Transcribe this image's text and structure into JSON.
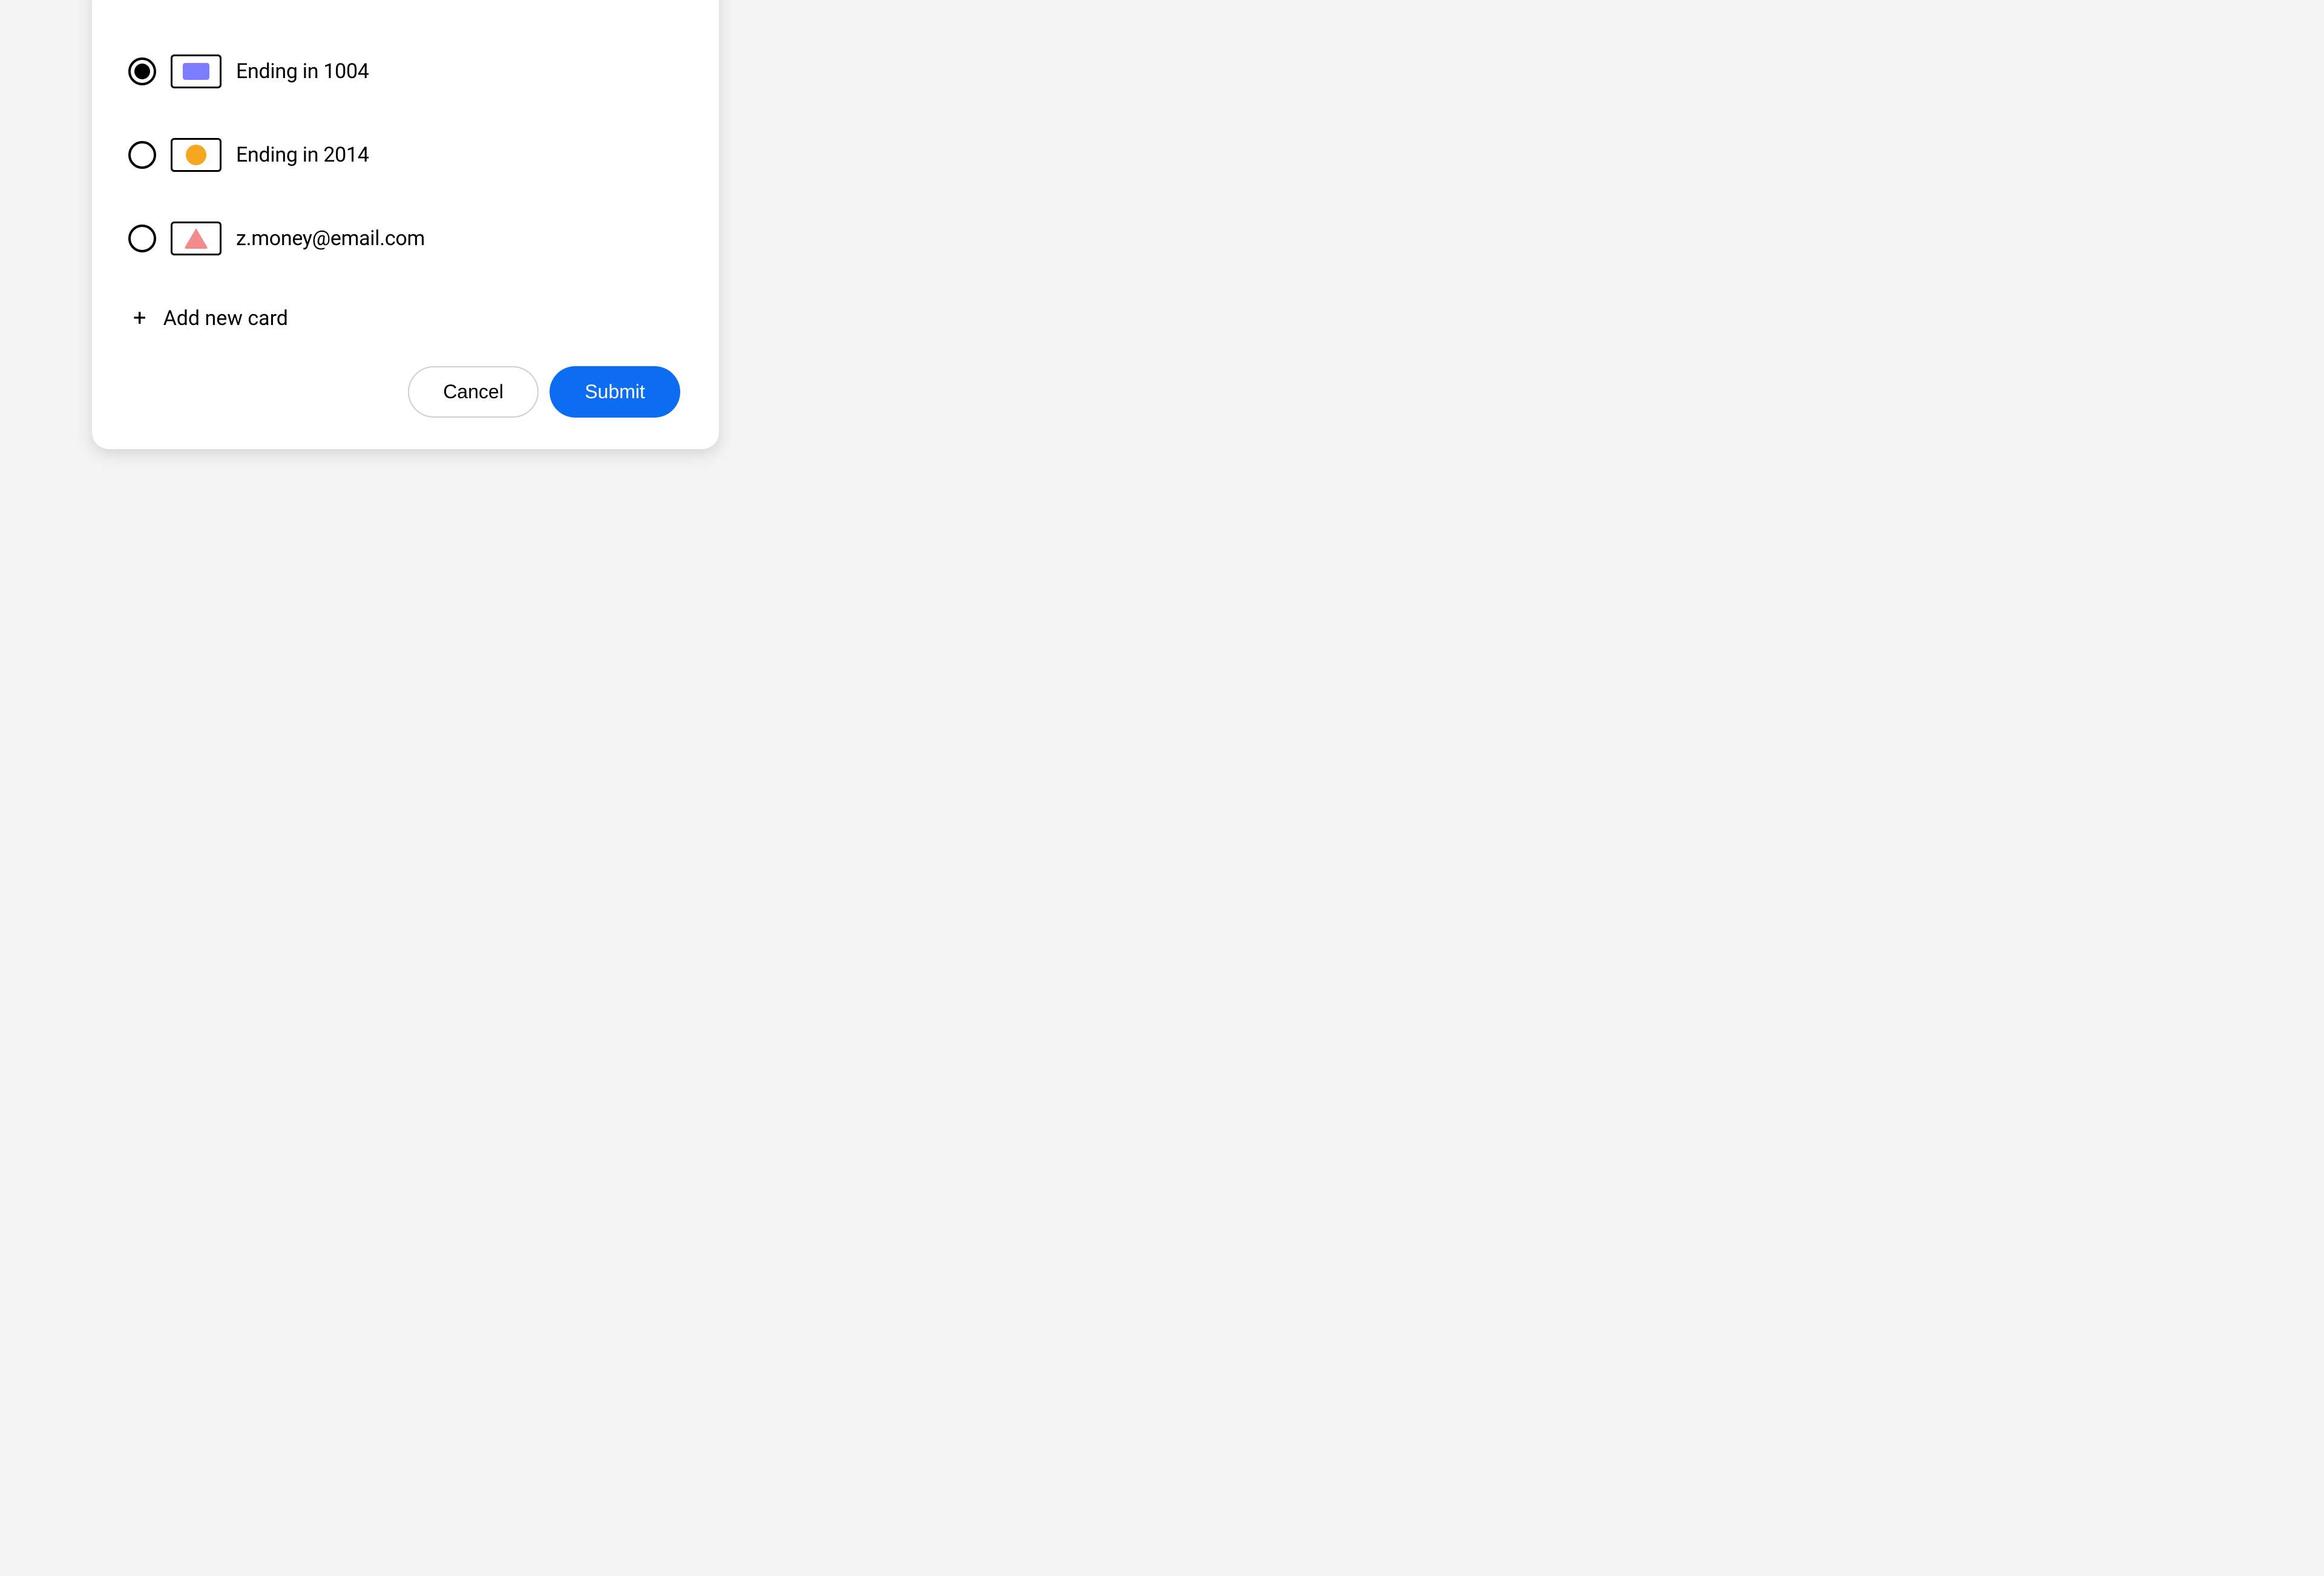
{
  "payment_methods": {
    "options": [
      {
        "label": "Ending in 1004",
        "selected": true,
        "icon_shape": "rect",
        "icon_color": "#7d7dff",
        "icon_name": "card-rectangle-icon"
      },
      {
        "label": "Ending in 2014",
        "selected": false,
        "icon_shape": "circle",
        "icon_color": "#f5a623",
        "icon_name": "card-circle-icon"
      },
      {
        "label": "z.money@email.com",
        "selected": false,
        "icon_shape": "triangle",
        "icon_color": "#f28b8b",
        "icon_name": "card-triangle-icon"
      }
    ],
    "add_card_label": "Add new card"
  },
  "buttons": {
    "cancel": "Cancel",
    "submit": "Submit"
  },
  "colors": {
    "primary": "#0c6cf2",
    "background": "#f3f3f3",
    "surface": "#ffffff",
    "border": "#cfcfcf"
  }
}
